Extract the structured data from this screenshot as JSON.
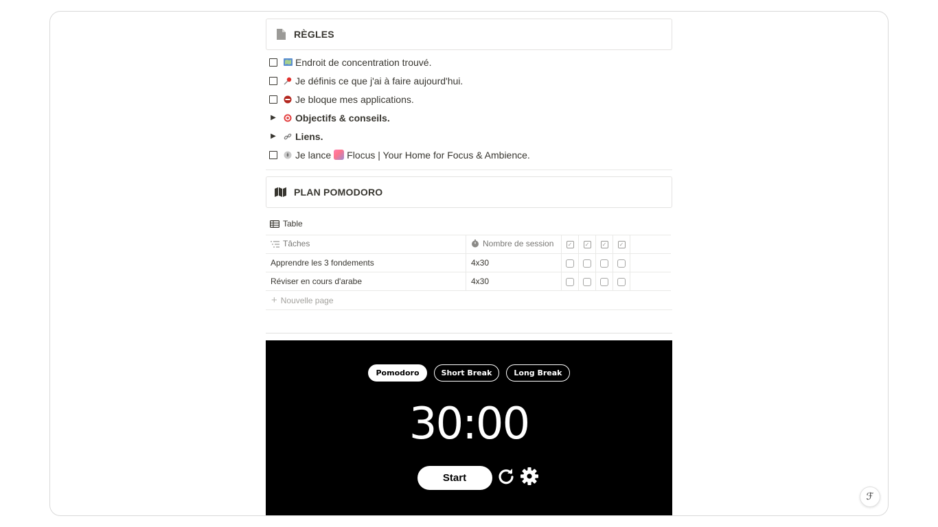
{
  "rules": {
    "title": "RÈGLES",
    "items": [
      {
        "type": "todo",
        "emoji": "map-icon",
        "text": "Endroit de concentration trouvé."
      },
      {
        "type": "todo",
        "emoji": "pushpin-icon",
        "text": "Je définis ce que j'ai à faire aujourd'hui."
      },
      {
        "type": "todo",
        "emoji": "stop-icon",
        "text": "Je bloque mes applications."
      },
      {
        "type": "toggle",
        "emoji": "target-icon",
        "text": "Objectifs & conseils."
      },
      {
        "type": "toggle",
        "emoji": "link-icon",
        "text": "Liens."
      },
      {
        "type": "todo",
        "emoji": "rocket-icon",
        "text_before": "Je lance",
        "text_after": "Flocus | Your Home for Focus & Ambience."
      }
    ]
  },
  "plan": {
    "title": "PLAN POMODORO",
    "view_label": "Table",
    "columns": {
      "tasks": "Tâches",
      "sessions": "Nombre de session"
    },
    "rows": [
      {
        "task": "Apprendre les 3 fondements",
        "sessions": "4x30"
      },
      {
        "task": "Réviser en cours d'arabe",
        "sessions": "4x30"
      }
    ],
    "new_page_label": "Nouvelle page"
  },
  "timer": {
    "modes": [
      "Pomodoro",
      "Short Break",
      "Long Break"
    ],
    "active_mode": "Pomodoro",
    "time": "30:00",
    "start_label": "Start"
  },
  "help": {
    "label": "?"
  },
  "colors": {
    "text": "#37352f",
    "muted": "#787774",
    "border": "#e9e9e7",
    "timer_bg": "#000000"
  }
}
